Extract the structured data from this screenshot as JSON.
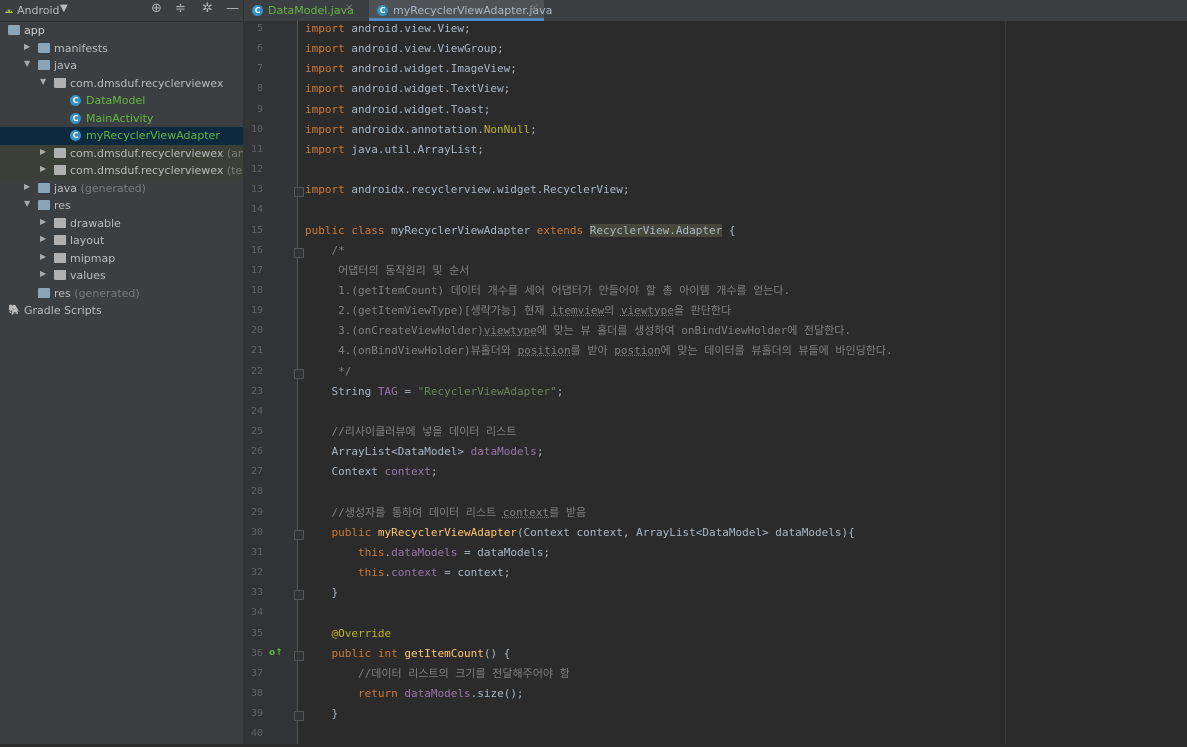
{
  "sidebar": {
    "project_view": "Android",
    "tree": [
      {
        "label": "app",
        "indent": 0,
        "arrow": "",
        "icon": "module-icon",
        "color": "bright"
      },
      {
        "label": "manifests",
        "indent": 1,
        "arrow": "▶",
        "icon": "folder-icon"
      },
      {
        "label": "java",
        "indent": 1,
        "arrow": "▼",
        "icon": "folder-icon"
      },
      {
        "label": "com.dmsduf.recyclerviewex",
        "indent": 2,
        "arrow": "▼",
        "icon": "package-icon"
      },
      {
        "label": "DataModel",
        "indent": 3,
        "arrow": "",
        "icon": "class-icon",
        "color": "green"
      },
      {
        "label": "MainActivity",
        "indent": 3,
        "arrow": "",
        "icon": "class-icon",
        "color": "green"
      },
      {
        "label": "myRecyclerViewAdapter",
        "indent": 3,
        "arrow": "",
        "icon": "class-icon",
        "color": "green",
        "selected": true
      },
      {
        "label": "com.dmsduf.recyclerviewex",
        "suffix": " (androidTest)",
        "indent": 2,
        "arrow": "▶",
        "icon": "package-icon",
        "tested": true
      },
      {
        "label": "com.dmsduf.recyclerviewex",
        "suffix": " (test)",
        "indent": 2,
        "arrow": "▶",
        "icon": "package-icon",
        "tested": true
      },
      {
        "label": "java",
        "suffix": " (generated)",
        "indent": 1,
        "arrow": "▶",
        "icon": "generated-folder-icon"
      },
      {
        "label": "res",
        "indent": 1,
        "arrow": "▼",
        "icon": "res-folder-icon"
      },
      {
        "label": "drawable",
        "indent": 2,
        "arrow": "▶",
        "icon": "package-icon"
      },
      {
        "label": "layout",
        "indent": 2,
        "arrow": "▶",
        "icon": "package-icon"
      },
      {
        "label": "mipmap",
        "indent": 2,
        "arrow": "▶",
        "icon": "package-icon"
      },
      {
        "label": "values",
        "indent": 2,
        "arrow": "▶",
        "icon": "package-icon"
      },
      {
        "label": "res",
        "suffix": " (generated)",
        "indent": 1,
        "arrow": "",
        "icon": "res-folder-icon"
      },
      {
        "label": "Gradle Scripts",
        "indent": 0,
        "arrow": "",
        "icon": "gradle-icon"
      }
    ]
  },
  "tabs": [
    {
      "label": "DataModel.java",
      "active": false
    },
    {
      "label": "myRecyclerViewAdapter.java",
      "active": true
    }
  ],
  "lines": [
    {
      "n": "5",
      "seg": [
        [
          "kw",
          "import "
        ],
        [
          "",
          "android.view.View;"
        ]
      ]
    },
    {
      "n": "6",
      "seg": [
        [
          "kw",
          "import "
        ],
        [
          "",
          "android.view.ViewGroup;"
        ]
      ]
    },
    {
      "n": "7",
      "seg": [
        [
          "kw",
          "import "
        ],
        [
          "",
          "android.widget.ImageView;"
        ]
      ]
    },
    {
      "n": "8",
      "seg": [
        [
          "kw",
          "import "
        ],
        [
          "",
          "android.widget.TextView;"
        ]
      ]
    },
    {
      "n": "9",
      "seg": [
        [
          "kw",
          "import "
        ],
        [
          "",
          "android.widget.Toast;"
        ]
      ]
    },
    {
      "n": "10",
      "seg": [
        [
          "kw",
          "import "
        ],
        [
          "",
          "androidx.annotation."
        ],
        [
          "ann",
          "NonNull"
        ],
        [
          "",
          ";"
        ]
      ]
    },
    {
      "n": "11",
      "seg": [
        [
          "kw",
          "import "
        ],
        [
          "",
          "java.util.ArrayList;"
        ]
      ]
    },
    {
      "n": "12",
      "seg": []
    },
    {
      "n": "13",
      "fold": true,
      "seg": [
        [
          "kw",
          "import "
        ],
        [
          "",
          "androidx.recyclerview.widget.RecyclerView;"
        ]
      ]
    },
    {
      "n": "14",
      "seg": []
    },
    {
      "n": "15",
      "seg": [
        [
          "kw",
          "public class "
        ],
        [
          "",
          "myRecyclerViewAdapter "
        ],
        [
          "kw",
          "extends "
        ],
        [
          "hl",
          "RecyclerView.Adapter"
        ],
        [
          "",
          " {"
        ]
      ]
    },
    {
      "n": "16",
      "fold": true,
      "seg": [
        [
          "cmt",
          "    /*"
        ]
      ]
    },
    {
      "n": "17",
      "seg": [
        [
          "cmt",
          "     어댑터의 동작원리 및 순서"
        ]
      ]
    },
    {
      "n": "18",
      "seg": [
        [
          "cmt",
          "     1.(getItemCount) 데이터 개수를 세어 어댑터가 만들어야 할 총 아이템 개수를 얻는다."
        ]
      ]
    },
    {
      "n": "19",
      "seg": [
        [
          "cmt",
          "     2.(getItemViewType)[생략가능] 현재 "
        ],
        [
          "cmt und",
          "itemview"
        ],
        [
          "cmt",
          "의 "
        ],
        [
          "cmt und",
          "viewtype"
        ],
        [
          "cmt",
          "을 판단한다"
        ]
      ]
    },
    {
      "n": "20",
      "seg": [
        [
          "cmt",
          "     3.(onCreateViewHolder)"
        ],
        [
          "cmt und",
          "viewtype"
        ],
        [
          "cmt",
          "에 맞는 뷰 홀더를 생성하여 onBindViewHolder에 전달한다."
        ]
      ]
    },
    {
      "n": "21",
      "seg": [
        [
          "cmt",
          "     4.(onBindViewHolder)뷰홀더와 "
        ],
        [
          "cmt und",
          "position"
        ],
        [
          "cmt",
          "를 받아 "
        ],
        [
          "cmt und",
          "postion"
        ],
        [
          "cmt",
          "에 맞는 데이터를 뷰홀더의 뷰들에 바인딩한다."
        ]
      ]
    },
    {
      "n": "22",
      "fold": true,
      "seg": [
        [
          "cmt",
          "     */"
        ]
      ]
    },
    {
      "n": "23",
      "seg": [
        [
          "",
          "    String "
        ],
        [
          "fld",
          "TAG"
        ],
        [
          "",
          " = "
        ],
        [
          "str",
          "\"RecyclerViewAdapter\""
        ],
        [
          "",
          ";"
        ]
      ]
    },
    {
      "n": "24",
      "seg": []
    },
    {
      "n": "25",
      "seg": [
        [
          "cmt",
          "    //리사이클러뷰에 넣을 데이터 리스트"
        ]
      ]
    },
    {
      "n": "26",
      "seg": [
        [
          "",
          "    ArrayList<DataModel> "
        ],
        [
          "fld",
          "dataModels"
        ],
        [
          "",
          ";"
        ]
      ]
    },
    {
      "n": "27",
      "seg": [
        [
          "",
          "    Context "
        ],
        [
          "fld",
          "context"
        ],
        [
          "",
          ";"
        ]
      ]
    },
    {
      "n": "28",
      "seg": []
    },
    {
      "n": "29",
      "seg": [
        [
          "cmt",
          "    //생성자를 통하여 데이터 리스트 "
        ],
        [
          "cmt und",
          "context"
        ],
        [
          "cmt",
          "를 받음"
        ]
      ]
    },
    {
      "n": "30",
      "fold": true,
      "seg": [
        [
          "kw",
          "    public "
        ],
        [
          "fn",
          "myRecyclerViewAdapter"
        ],
        [
          "",
          "(Context context, ArrayList<DataModel> dataModels){"
        ]
      ]
    },
    {
      "n": "31",
      "seg": [
        [
          "kw",
          "        this"
        ],
        [
          "",
          ".",
          ""
        ],
        [
          "fld",
          "dataModels"
        ],
        [
          "",
          " = dataModels;"
        ]
      ]
    },
    {
      "n": "32",
      "seg": [
        [
          "kw",
          "        this"
        ],
        [
          "",
          "."
        ],
        [
          "fld",
          "context"
        ],
        [
          "",
          " = context;"
        ]
      ]
    },
    {
      "n": "33",
      "fold": true,
      "seg": [
        [
          "",
          "    }"
        ]
      ]
    },
    {
      "n": "34",
      "seg": []
    },
    {
      "n": "35",
      "seg": [
        [
          "ann",
          "    @Override"
        ]
      ]
    },
    {
      "n": "36",
      "fold": true,
      "marker": "o↑",
      "seg": [
        [
          "kw",
          "    public int "
        ],
        [
          "fn",
          "getItemCount"
        ],
        [
          "",
          "() {"
        ]
      ]
    },
    {
      "n": "37",
      "seg": [
        [
          "cmt",
          "        //데이터 리스트의 크기를 전달해주어야 함"
        ]
      ]
    },
    {
      "n": "38",
      "seg": [
        [
          "kw",
          "        return "
        ],
        [
          "fld",
          "dataModels"
        ],
        [
          "",
          ".size();"
        ]
      ]
    },
    {
      "n": "39",
      "fold": true,
      "seg": [
        [
          "",
          "    }"
        ]
      ]
    },
    {
      "n": "40",
      "seg": []
    }
  ],
  "colors": {
    "marker": "#62b543",
    "selection": "#0d293e",
    "accent": "#4a88c7"
  }
}
